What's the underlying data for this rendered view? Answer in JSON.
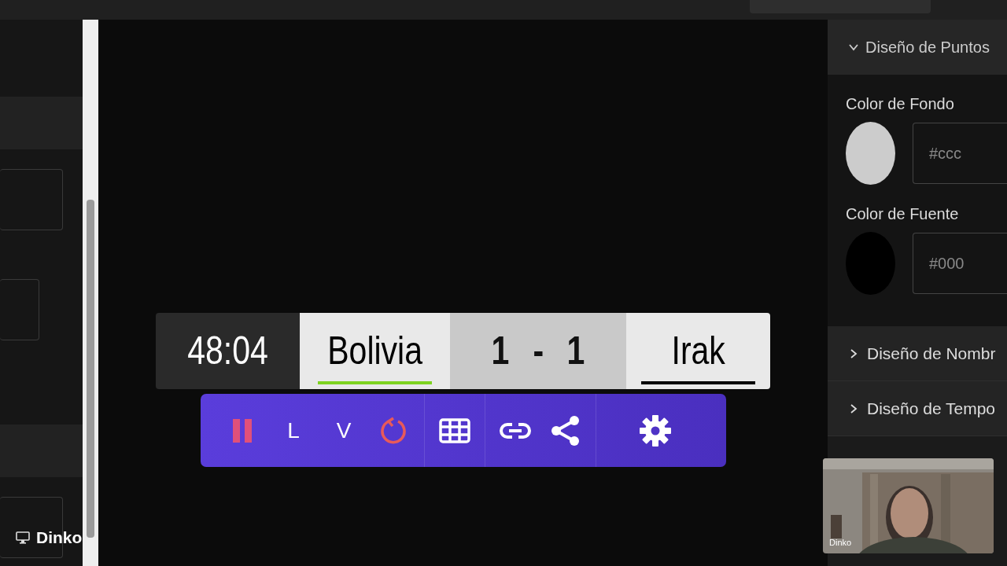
{
  "presenter": {
    "name": "Dinko"
  },
  "scoreboard": {
    "clock": "48:04",
    "score_home": "1",
    "separator": "-",
    "score_away": "1",
    "teams": [
      {
        "name": "Bolivia",
        "color": "#7ed321"
      },
      {
        "name": "Irak",
        "color": "#000000"
      }
    ]
  },
  "control_groups": [
    [
      {
        "kind": "pause",
        "color": "#e0507a"
      },
      {
        "kind": "letter",
        "label": "L"
      },
      {
        "kind": "letter",
        "label": "V"
      },
      {
        "kind": "reset",
        "color": "#e85a5a"
      }
    ],
    [
      {
        "kind": "grid"
      }
    ],
    [
      {
        "kind": "link"
      },
      {
        "kind": "share"
      }
    ],
    [
      {
        "kind": "settings"
      }
    ]
  ],
  "right_panel": {
    "header": {
      "title": "Diseño de Puntos",
      "expanded": true
    },
    "fields": [
      {
        "label": "Color de Fondo",
        "color": "#cccccc",
        "value": "#ccc"
      },
      {
        "label": "Color de Fuente",
        "color": "#000000",
        "value": "#000"
      }
    ],
    "sections": [
      {
        "title": "Diseño de Nombr",
        "expanded": false
      },
      {
        "title": "Diseño de Tempo",
        "expanded": false
      }
    ]
  },
  "webcam": {
    "name": "Dinko"
  }
}
